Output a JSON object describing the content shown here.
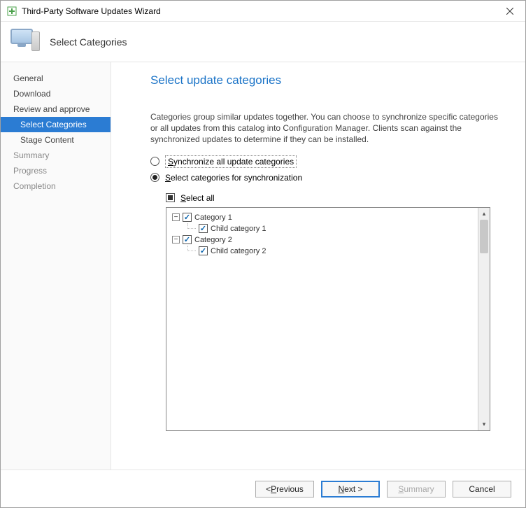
{
  "window": {
    "title": "Third-Party Software Updates Wizard"
  },
  "header": {
    "title": "Select Categories"
  },
  "sidebar": {
    "items": [
      {
        "label": "General",
        "selected": false,
        "sub": false,
        "dim": false
      },
      {
        "label": "Download",
        "selected": false,
        "sub": false,
        "dim": false
      },
      {
        "label": "Review and approve",
        "selected": false,
        "sub": false,
        "dim": false
      },
      {
        "label": "Select Categories",
        "selected": true,
        "sub": true,
        "dim": false
      },
      {
        "label": "Stage Content",
        "selected": false,
        "sub": true,
        "dim": false
      },
      {
        "label": "Summary",
        "selected": false,
        "sub": false,
        "dim": true
      },
      {
        "label": "Progress",
        "selected": false,
        "sub": false,
        "dim": true
      },
      {
        "label": "Completion",
        "selected": false,
        "sub": false,
        "dim": true
      }
    ]
  },
  "content": {
    "page_title": "Select update categories",
    "description": "Categories group similar updates together. You can choose to synchronize specific categories or all updates from this catalog into Configuration Manager. Clients scan against the synchronized updates to determine if they can be installed.",
    "radio_sync_all_prefix": "S",
    "radio_sync_all_rest": "ynchronize all update categories",
    "radio_select_prefix": "S",
    "radio_select_rest": "elect categories for synchronization",
    "select_all_prefix": "S",
    "select_all_rest": "elect all",
    "tree": [
      {
        "level": 0,
        "expandable": true,
        "checked": true,
        "label": "Category 1"
      },
      {
        "level": 1,
        "expandable": false,
        "checked": true,
        "label": "Child category 1"
      },
      {
        "level": 0,
        "expandable": true,
        "checked": true,
        "label": "Category 2"
      },
      {
        "level": 1,
        "expandable": false,
        "checked": true,
        "label": "Child category 2"
      }
    ]
  },
  "footer": {
    "previous_prefix": "< ",
    "previous_u": "P",
    "previous_rest": "revious",
    "next_u": "N",
    "next_rest": "ext >",
    "summary_u": "S",
    "summary_rest": "ummary",
    "cancel": "Cancel"
  }
}
